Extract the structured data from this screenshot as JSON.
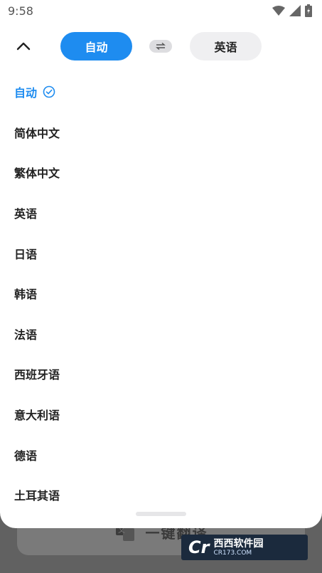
{
  "status_bar": {
    "time": "9:58"
  },
  "header": {
    "source_language": "自动",
    "target_language": "英语"
  },
  "languages": [
    {
      "label": "自动",
      "selected": true
    },
    {
      "label": "简体中文",
      "selected": false
    },
    {
      "label": "繁体中文",
      "selected": false
    },
    {
      "label": "英语",
      "selected": false
    },
    {
      "label": "日语",
      "selected": false
    },
    {
      "label": "韩语",
      "selected": false
    },
    {
      "label": "法语",
      "selected": false
    },
    {
      "label": "西班牙语",
      "selected": false
    },
    {
      "label": "意大利语",
      "selected": false
    },
    {
      "label": "德语",
      "selected": false
    },
    {
      "label": "土耳其语",
      "selected": false
    }
  ],
  "background": {
    "translate_button_label": "一键翻译"
  },
  "watermark": {
    "logo": "Cr",
    "name": "西西软件园",
    "site": "CR173.COM"
  },
  "colors": {
    "accent": "#1e8cf0",
    "pill_gray": "#efeff1"
  },
  "icons": [
    "chevron-up-icon",
    "swap-icon",
    "check-circle-icon",
    "wifi-icon",
    "signal-icon",
    "battery-icon",
    "translate-icon"
  ]
}
